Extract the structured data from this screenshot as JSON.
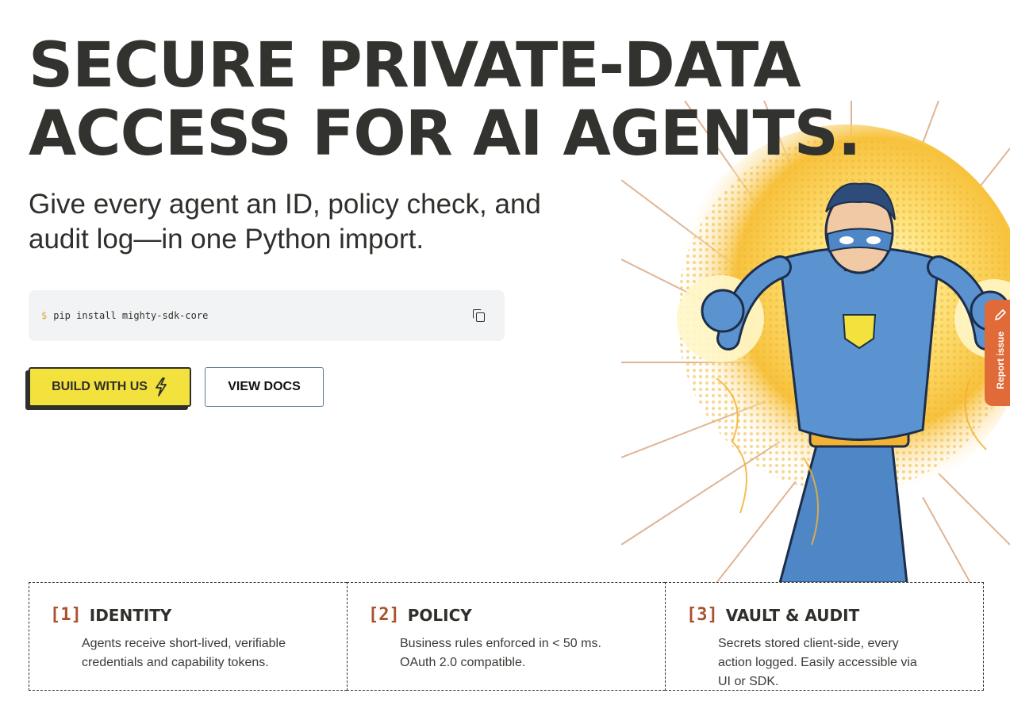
{
  "hero": {
    "title_line1": "SECURE PRIVATE-DATA",
    "title_line2": "ACCESS FOR AI AGENTS.",
    "subtitle": "Give every agent an ID, policy check, and audit log—in one Python import."
  },
  "install": {
    "prompt": "$",
    "command": "pip install mighty-sdk-core",
    "copy_icon": "copy-icon"
  },
  "actions": {
    "build_label": "BUILD WITH US",
    "build_icon": "lightning-icon",
    "docs_label": "VIEW DOCS"
  },
  "report_tab": {
    "label": "Report issue",
    "icon": "pencil-icon"
  },
  "features": [
    {
      "num": "[1]",
      "title": "IDENTITY",
      "desc": "Agents receive short-lived, verifiable credentials and capability tokens."
    },
    {
      "num": "[2]",
      "title": "POLICY",
      "desc": "Business rules enforced in < 50 ms. OAuth 2.0 compatible."
    },
    {
      "num": "[3]",
      "title": "VAULT & AUDIT",
      "desc": "Secrets stored client-side, every action logged. Easily accessible via UI or SDK."
    }
  ],
  "colors": {
    "accent_yellow": "#f3e13d",
    "accent_orange": "#e06a38",
    "number_brown": "#a9522c",
    "text_dark": "#2f302b"
  }
}
